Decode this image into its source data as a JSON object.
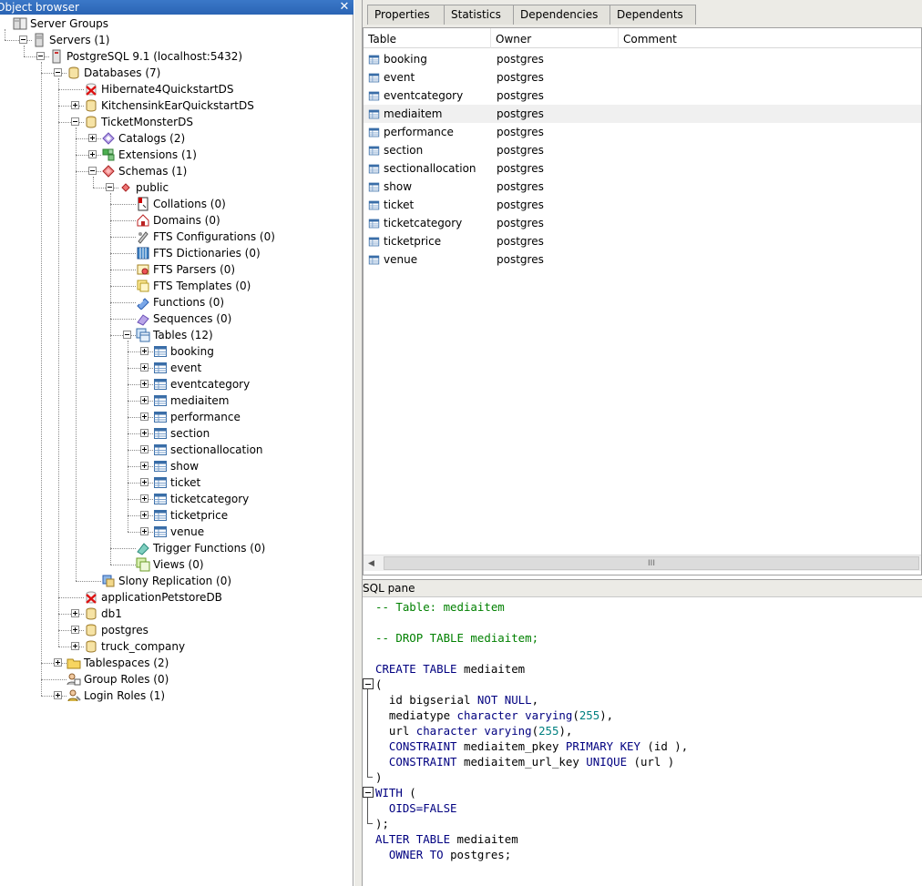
{
  "object_browser": {
    "title": "Object browser",
    "tree": [
      {
        "label": "Server Groups",
        "icon": "server-groups-icon",
        "depth": 0,
        "expander": "none"
      },
      {
        "label": "Servers (1)",
        "icon": "servers-icon",
        "depth": 1,
        "expander": "minus"
      },
      {
        "label": "PostgreSQL 9.1 (localhost:5432)",
        "icon": "server-icon",
        "depth": 2,
        "expander": "minus"
      },
      {
        "label": "Databases (7)",
        "icon": "databases-icon",
        "depth": 3,
        "expander": "minus"
      },
      {
        "label": "Hibernate4QuickstartDS",
        "icon": "database-disconnected-icon",
        "depth": 4,
        "expander": "none"
      },
      {
        "label": "KitchensinkEarQuickstartDS",
        "icon": "database-icon",
        "depth": 4,
        "expander": "plus"
      },
      {
        "label": "TicketMonsterDS",
        "icon": "database-icon",
        "depth": 4,
        "expander": "minus"
      },
      {
        "label": "Catalogs (2)",
        "icon": "catalogs-icon",
        "depth": 5,
        "expander": "plus"
      },
      {
        "label": "Extensions (1)",
        "icon": "extensions-icon",
        "depth": 5,
        "expander": "plus"
      },
      {
        "label": "Schemas (1)",
        "icon": "schemas-icon",
        "depth": 5,
        "expander": "minus"
      },
      {
        "label": "public",
        "icon": "schema-icon",
        "depth": 6,
        "expander": "minus"
      },
      {
        "label": "Collations (0)",
        "icon": "collations-icon",
        "depth": 7,
        "expander": "none"
      },
      {
        "label": "Domains (0)",
        "icon": "domains-icon",
        "depth": 7,
        "expander": "none"
      },
      {
        "label": "FTS Configurations (0)",
        "icon": "fts-configurations-icon",
        "depth": 7,
        "expander": "none"
      },
      {
        "label": "FTS Dictionaries (0)",
        "icon": "fts-dictionaries-icon",
        "depth": 7,
        "expander": "none"
      },
      {
        "label": "FTS Parsers (0)",
        "icon": "fts-parsers-icon",
        "depth": 7,
        "expander": "none"
      },
      {
        "label": "FTS Templates (0)",
        "icon": "fts-templates-icon",
        "depth": 7,
        "expander": "none"
      },
      {
        "label": "Functions (0)",
        "icon": "functions-icon",
        "depth": 7,
        "expander": "none"
      },
      {
        "label": "Sequences (0)",
        "icon": "sequences-icon",
        "depth": 7,
        "expander": "none"
      },
      {
        "label": "Tables (12)",
        "icon": "tables-icon",
        "depth": 7,
        "expander": "minus"
      },
      {
        "label": "booking",
        "icon": "table-icon",
        "depth": 8,
        "expander": "plus"
      },
      {
        "label": "event",
        "icon": "table-icon",
        "depth": 8,
        "expander": "plus"
      },
      {
        "label": "eventcategory",
        "icon": "table-icon",
        "depth": 8,
        "expander": "plus"
      },
      {
        "label": "mediaitem",
        "icon": "table-icon",
        "depth": 8,
        "expander": "plus"
      },
      {
        "label": "performance",
        "icon": "table-icon",
        "depth": 8,
        "expander": "plus"
      },
      {
        "label": "section",
        "icon": "table-icon",
        "depth": 8,
        "expander": "plus"
      },
      {
        "label": "sectionallocation",
        "icon": "table-icon",
        "depth": 8,
        "expander": "plus"
      },
      {
        "label": "show",
        "icon": "table-icon",
        "depth": 8,
        "expander": "plus"
      },
      {
        "label": "ticket",
        "icon": "table-icon",
        "depth": 8,
        "expander": "plus"
      },
      {
        "label": "ticketcategory",
        "icon": "table-icon",
        "depth": 8,
        "expander": "plus"
      },
      {
        "label": "ticketprice",
        "icon": "table-icon",
        "depth": 8,
        "expander": "plus"
      },
      {
        "label": "venue",
        "icon": "table-icon",
        "depth": 8,
        "expander": "plus"
      },
      {
        "label": "Trigger Functions (0)",
        "icon": "trigger-functions-icon",
        "depth": 7,
        "expander": "none"
      },
      {
        "label": "Views (0)",
        "icon": "views-icon",
        "depth": 7,
        "expander": "none"
      },
      {
        "label": "Slony Replication (0)",
        "icon": "slony-replication-icon",
        "depth": 5,
        "expander": "none"
      },
      {
        "label": "applicationPetstoreDB",
        "icon": "database-disconnected-icon",
        "depth": 4,
        "expander": "none"
      },
      {
        "label": "db1",
        "icon": "database-icon",
        "depth": 4,
        "expander": "plus"
      },
      {
        "label": "postgres",
        "icon": "database-icon",
        "depth": 4,
        "expander": "plus"
      },
      {
        "label": "truck_company",
        "icon": "database-icon",
        "depth": 4,
        "expander": "plus"
      },
      {
        "label": "Tablespaces (2)",
        "icon": "tablespaces-icon",
        "depth": 3,
        "expander": "plus"
      },
      {
        "label": "Group Roles (0)",
        "icon": "group-roles-icon",
        "depth": 3,
        "expander": "none"
      },
      {
        "label": "Login Roles (1)",
        "icon": "login-roles-icon",
        "depth": 3,
        "expander": "plus"
      }
    ]
  },
  "properties": {
    "tabs": [
      {
        "label": "Properties",
        "active": true
      },
      {
        "label": "Statistics",
        "active": false
      },
      {
        "label": "Dependencies",
        "active": false
      },
      {
        "label": "Dependents",
        "active": false
      }
    ],
    "columns": [
      "Table",
      "Owner",
      "Comment"
    ],
    "rows": [
      {
        "table": "booking",
        "owner": "postgres",
        "comment": "",
        "selected": false
      },
      {
        "table": "event",
        "owner": "postgres",
        "comment": "",
        "selected": false
      },
      {
        "table": "eventcategory",
        "owner": "postgres",
        "comment": "",
        "selected": false
      },
      {
        "table": "mediaitem",
        "owner": "postgres",
        "comment": "",
        "selected": true
      },
      {
        "table": "performance",
        "owner": "postgres",
        "comment": "",
        "selected": false
      },
      {
        "table": "section",
        "owner": "postgres",
        "comment": "",
        "selected": false
      },
      {
        "table": "sectionallocation",
        "owner": "postgres",
        "comment": "",
        "selected": false
      },
      {
        "table": "show",
        "owner": "postgres",
        "comment": "",
        "selected": false
      },
      {
        "table": "ticket",
        "owner": "postgres",
        "comment": "",
        "selected": false
      },
      {
        "table": "ticketcategory",
        "owner": "postgres",
        "comment": "",
        "selected": false
      },
      {
        "table": "ticketprice",
        "owner": "postgres",
        "comment": "",
        "selected": false
      },
      {
        "table": "venue",
        "owner": "postgres",
        "comment": "",
        "selected": false
      }
    ],
    "scroll_thumb_mark": "III"
  },
  "sql_pane": {
    "title": "SQL pane",
    "lines": [
      [
        {
          "t": "-- Table: mediaitem",
          "c": "cm"
        }
      ],
      [],
      [
        {
          "t": "-- DROP TABLE mediaitem;",
          "c": "cm"
        }
      ],
      [],
      [
        {
          "t": "CREATE TABLE",
          "c": "kw"
        },
        {
          "t": " mediaitem",
          "c": ""
        }
      ],
      [
        {
          "t": "(",
          "c": ""
        }
      ],
      [
        {
          "t": "  id bigserial ",
          "c": ""
        },
        {
          "t": "NOT NULL",
          "c": "kw"
        },
        {
          "t": ",",
          "c": ""
        }
      ],
      [
        {
          "t": "  mediatype ",
          "c": ""
        },
        {
          "t": "character varying",
          "c": "kw"
        },
        {
          "t": "(",
          "c": ""
        },
        {
          "t": "255",
          "c": "nm"
        },
        {
          "t": "),",
          "c": ""
        }
      ],
      [
        {
          "t": "  url ",
          "c": ""
        },
        {
          "t": "character varying",
          "c": "kw"
        },
        {
          "t": "(",
          "c": ""
        },
        {
          "t": "255",
          "c": "nm"
        },
        {
          "t": "),",
          "c": ""
        }
      ],
      [
        {
          "t": "  ",
          "c": ""
        },
        {
          "t": "CONSTRAINT",
          "c": "kw"
        },
        {
          "t": " mediaitem_pkey ",
          "c": ""
        },
        {
          "t": "PRIMARY KEY",
          "c": "kw"
        },
        {
          "t": " (id ),",
          "c": ""
        }
      ],
      [
        {
          "t": "  ",
          "c": ""
        },
        {
          "t": "CONSTRAINT",
          "c": "kw"
        },
        {
          "t": " mediaitem_url_key ",
          "c": ""
        },
        {
          "t": "UNIQUE",
          "c": "kw"
        },
        {
          "t": " (url )",
          "c": ""
        }
      ],
      [
        {
          "t": ")",
          "c": ""
        }
      ],
      [
        {
          "t": "WITH",
          "c": "kw"
        },
        {
          "t": " (",
          "c": ""
        }
      ],
      [
        {
          "t": "  ",
          "c": ""
        },
        {
          "t": "OIDS=FALSE",
          "c": "kw"
        }
      ],
      [
        {
          "t": ");",
          "c": ""
        }
      ],
      [
        {
          "t": "ALTER TABLE",
          "c": "kw"
        },
        {
          "t": " mediaitem",
          "c": ""
        }
      ],
      [
        {
          "t": "  ",
          "c": ""
        },
        {
          "t": "OWNER TO",
          "c": "kw"
        },
        {
          "t": " postgres;",
          "c": ""
        }
      ]
    ]
  }
}
